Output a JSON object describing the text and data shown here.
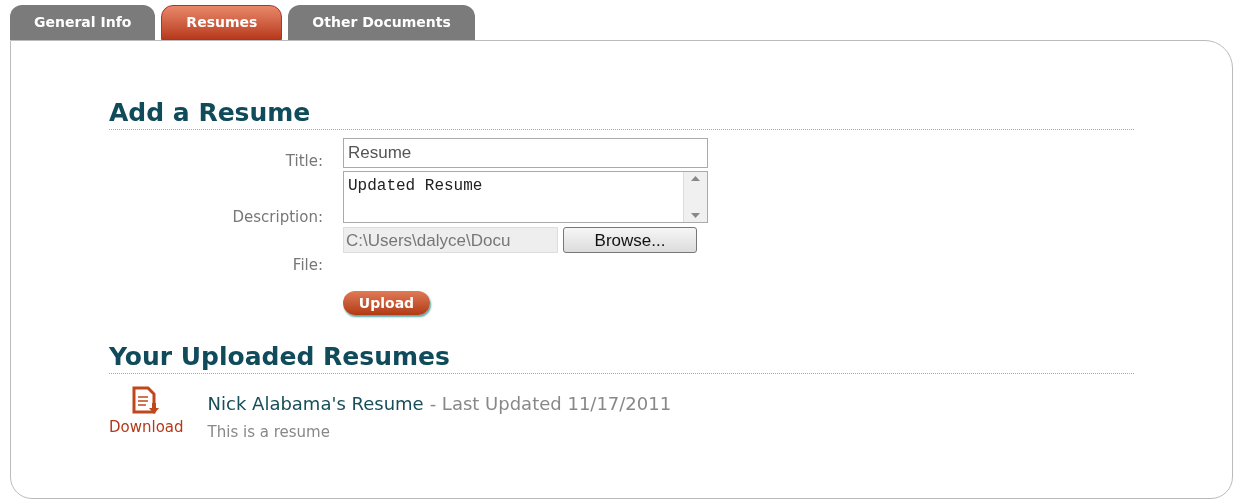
{
  "tabs": [
    {
      "label": "General Info",
      "selected": false
    },
    {
      "label": "Resumes",
      "selected": true
    },
    {
      "label": "Other Documents",
      "selected": false
    }
  ],
  "add_section": {
    "heading": "Add a Resume",
    "fields": [
      {
        "kind": "text",
        "label": "Title:",
        "value": "Resume"
      },
      {
        "kind": "textarea",
        "label": "Description:",
        "value": "Updated Resume"
      },
      {
        "kind": "file",
        "label": "File:",
        "value": "C:\\Users\\dalyce\\Docu",
        "button": "Browse..."
      }
    ],
    "submit": "Upload"
  },
  "uploaded_section": {
    "heading": "Your Uploaded Resumes",
    "items": [
      {
        "download": "Download",
        "title": "Nick Alabama's Resume",
        "updated": "- Last Updated 11/17/2011",
        "description": "This is a resume"
      }
    ]
  }
}
